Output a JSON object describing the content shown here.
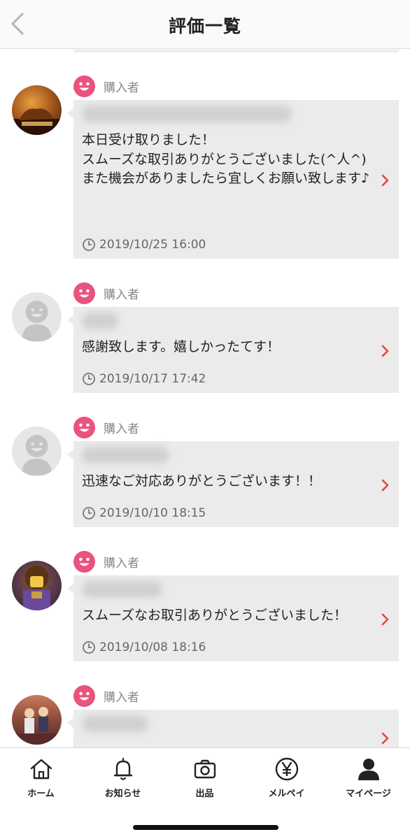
{
  "header": {
    "title": "評価一覧",
    "back_icon": "chevron-left-icon"
  },
  "colors": {
    "accent": "#e9537d",
    "chevron": "#e0483d",
    "bubble": "#ebebeb"
  },
  "reviews": [
    {
      "role": "購入者",
      "message": "本日受け取りました！\nスムーズな取引ありがとうございました(^人^)\nまた機会がありましたら宜しくお願い致します♪",
      "date": "2019/10/25 16:00"
    },
    {
      "role": "購入者",
      "message": "感謝致します。嬉しかったてす！",
      "date": "2019/10/17 17:42"
    },
    {
      "role": "購入者",
      "message": "迅速なご対応ありがとうございます！！",
      "date": "2019/10/10 18:15"
    },
    {
      "role": "購入者",
      "message": "スムーズなお取引ありがとうございました！",
      "date": "2019/10/08 18:16"
    },
    {
      "role": "購入者",
      "message": "",
      "date": ""
    }
  ],
  "tabbar": {
    "home": "ホーム",
    "notifications": "お知らせ",
    "sell": "出品",
    "merpay": "メルペイ",
    "mypage": "マイページ"
  }
}
